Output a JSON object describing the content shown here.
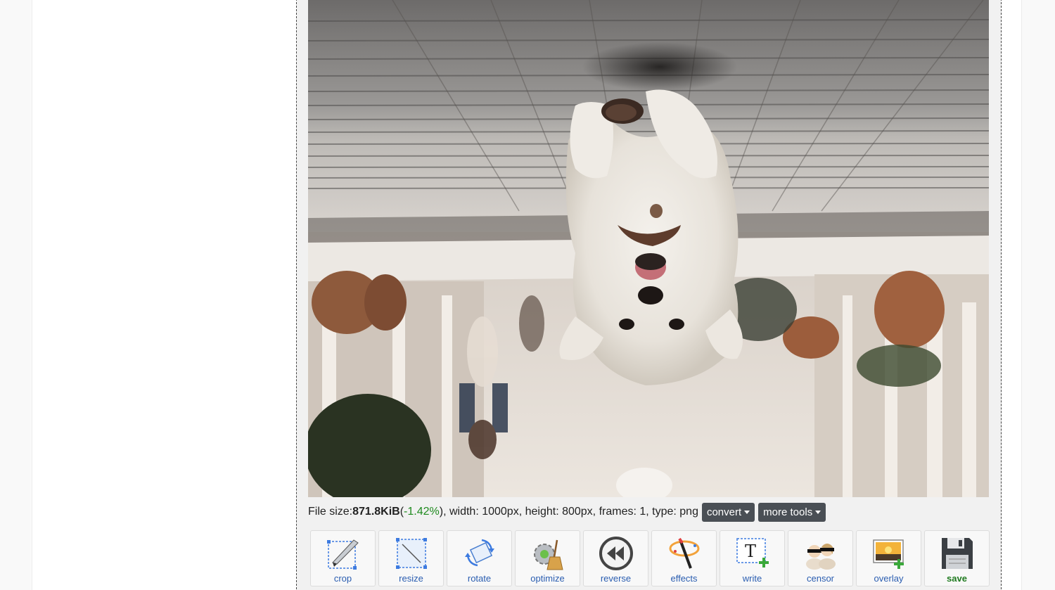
{
  "file_info": {
    "prefix": "File size: ",
    "size": "871.8KiB",
    "open_paren": " (",
    "percent": "-1.42%",
    "rest": "), width: 1000px, height: 800px, frames: 1, type: png"
  },
  "buttons": {
    "convert": "convert",
    "more_tools": "more tools"
  },
  "tools": [
    {
      "label": "crop",
      "icon": "crop-icon"
    },
    {
      "label": "resize",
      "icon": "resize-icon"
    },
    {
      "label": "rotate",
      "icon": "rotate-icon"
    },
    {
      "label": "optimize",
      "icon": "optimize-icon"
    },
    {
      "label": "reverse",
      "icon": "reverse-icon"
    },
    {
      "label": "effects",
      "icon": "effects-icon"
    },
    {
      "label": "write",
      "icon": "write-icon"
    },
    {
      "label": "censor",
      "icon": "censor-icon"
    },
    {
      "label": "overlay",
      "icon": "overlay-icon"
    },
    {
      "label": "save",
      "icon": "save-icon"
    }
  ],
  "colors": {
    "percent_green": "#1f8a1f",
    "link_blue": "#2a5db0",
    "dropdown_bg": "#4a4f55"
  }
}
